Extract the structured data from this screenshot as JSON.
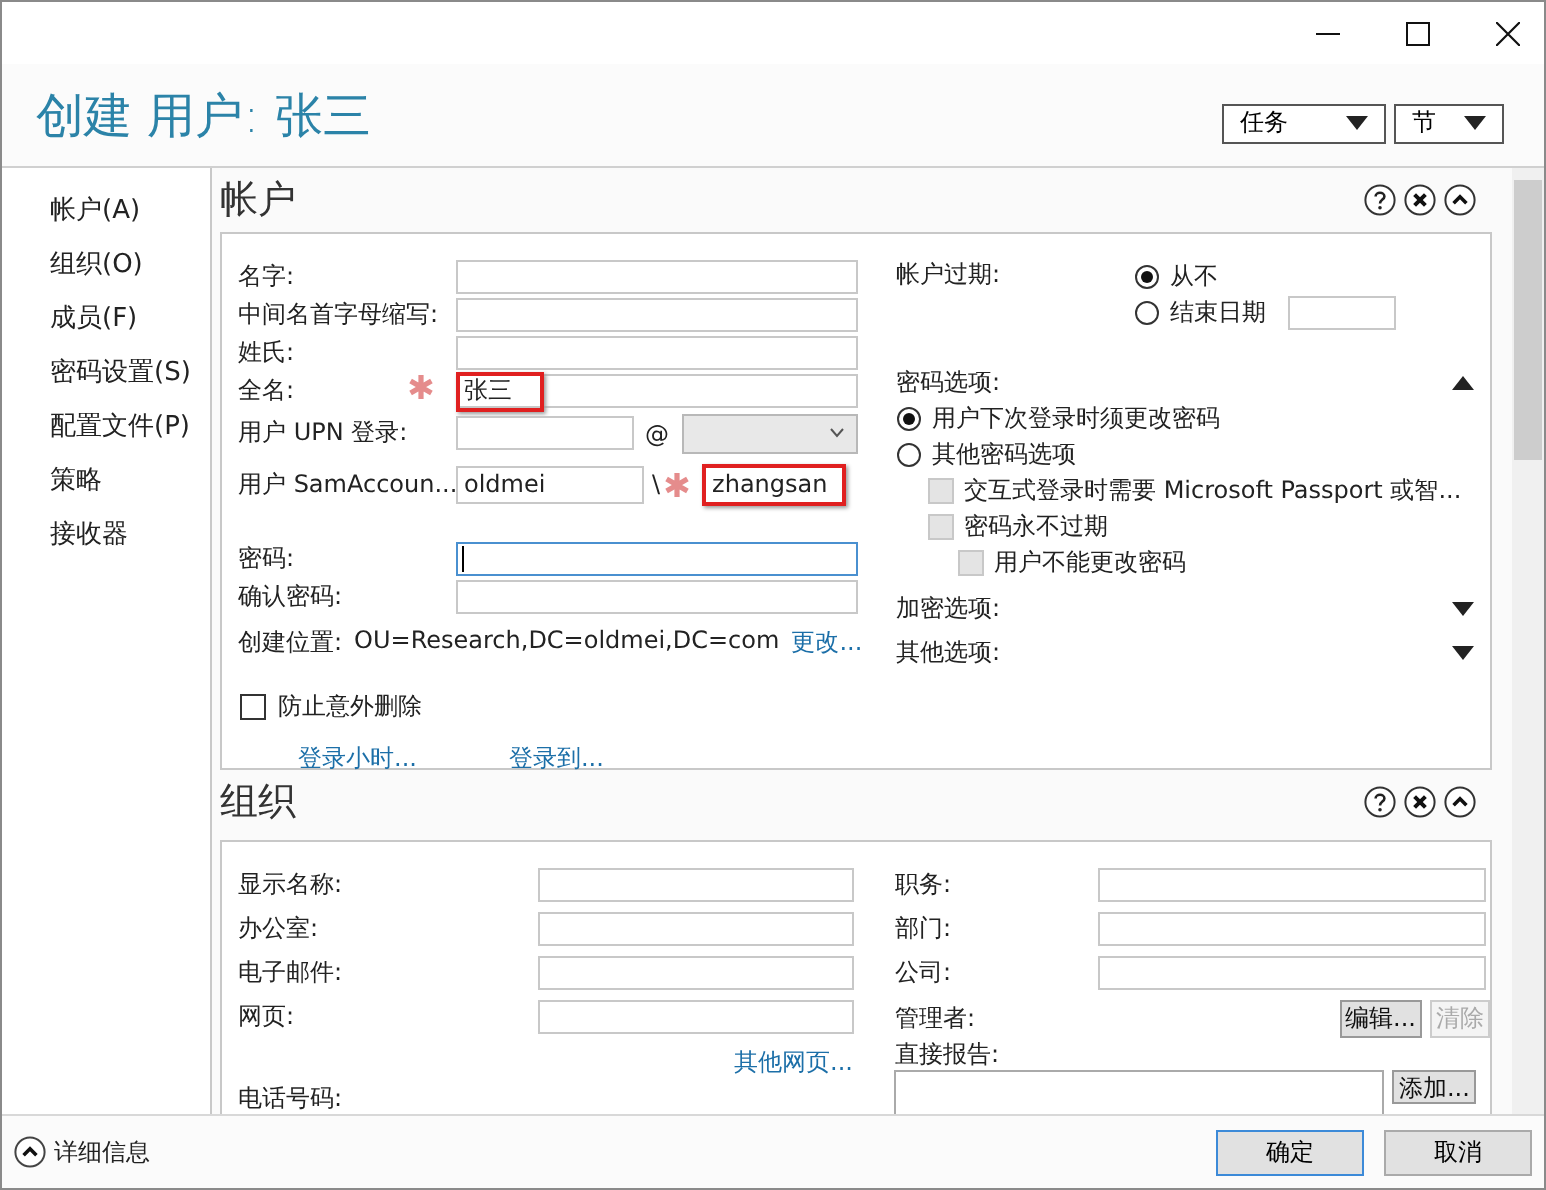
{
  "header": {
    "title": "创建 用户: 张三",
    "menus": [
      {
        "label": "任务"
      },
      {
        "label": "节"
      }
    ]
  },
  "nav": {
    "items": [
      {
        "label": "帐户(A)"
      },
      {
        "label": "组织(O)"
      },
      {
        "label": "成员(F)"
      },
      {
        "label": "密码设置(S)"
      },
      {
        "label": "配置文件(P)"
      },
      {
        "label": "策略"
      },
      {
        "label": "接收器"
      }
    ]
  },
  "account": {
    "title": "帐户",
    "fields": [
      {
        "kind": "text",
        "label": "名字:"
      },
      {
        "kind": "text",
        "label": "中间名首字母缩写:"
      },
      {
        "kind": "text",
        "label": "姓氏:"
      },
      {
        "kind": "text",
        "label": "全名:",
        "value": "张三",
        "required": true,
        "highlighted": true
      },
      {
        "kind": "upn",
        "label": "用户 UPN 登录:",
        "separator": "@"
      },
      {
        "kind": "sam",
        "label": "用户 SamAccoun...",
        "domain": "oldmei",
        "separator": "\\",
        "value": "zhangsan",
        "required": true,
        "highlighted": true
      },
      {
        "kind": "password",
        "label": "密码:",
        "focused": true
      },
      {
        "kind": "password",
        "label": "确认密码:",
        "focused": false
      }
    ],
    "location": {
      "label": "创建位置:",
      "value": "OU=Research,DC=oldmei,DC=com",
      "link": "更改..."
    },
    "protect": {
      "label": "防止意外删除",
      "checked": false
    },
    "links": [
      "登录小时...",
      "登录到..."
    ],
    "expiry": {
      "label": "帐户过期:",
      "options": [
        {
          "label": "从不",
          "selected": true
        },
        {
          "label": "结束日期",
          "selected": false
        }
      ]
    },
    "password_options": {
      "label": "密码选项:",
      "expanded": true,
      "options": [
        {
          "label": "用户下次登录时须更改密码",
          "selected": true
        },
        {
          "label": "其他密码选项",
          "selected": false
        }
      ],
      "checks": [
        {
          "label": "交互式登录时需要 Microsoft Passport 或智...",
          "checked": false,
          "disabled": true
        },
        {
          "label": "密码永不过期",
          "checked": false,
          "disabled": true,
          "children": [
            {
              "label": "用户不能更改密码",
              "checked": false,
              "disabled": true
            }
          ]
        }
      ]
    },
    "more": [
      {
        "label": "加密选项:",
        "expanded": false
      },
      {
        "label": "其他选项:",
        "expanded": false
      }
    ]
  },
  "organization": {
    "title": "组织",
    "left_fields": [
      {
        "label": "显示名称:"
      },
      {
        "label": "办公室:"
      },
      {
        "label": "电子邮件:"
      },
      {
        "label": "网页:"
      }
    ],
    "link": "其他网页...",
    "phone_label": "电话号码:",
    "right_fields": [
      {
        "label": "职务:"
      },
      {
        "label": "部门:"
      },
      {
        "label": "公司:"
      }
    ],
    "manager": {
      "label": "管理者:",
      "buttons": [
        {
          "label": "编辑...",
          "disabled": false
        },
        {
          "label": "清除",
          "disabled": true
        }
      ]
    },
    "reports": {
      "label": "直接报告:",
      "button": "添加..."
    }
  },
  "footer": {
    "details": "详细信息",
    "buttons": [
      {
        "label": "确定",
        "default": true
      },
      {
        "label": "取消",
        "default": false
      }
    ]
  }
}
